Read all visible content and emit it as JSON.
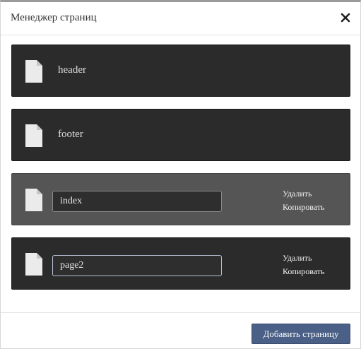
{
  "dialog": {
    "title": "Менеджер страниц",
    "close_icon": "close-icon"
  },
  "pages": [
    {
      "name": "header",
      "state": "static",
      "icon": "file-icon"
    },
    {
      "name": "footer",
      "state": "static",
      "icon": "file-icon"
    },
    {
      "name": "index",
      "state": "selected",
      "icon": "file-icon",
      "delete_label": "Удалить",
      "copy_label": "Копировать"
    },
    {
      "name": "page2",
      "state": "editing",
      "icon": "file-icon",
      "delete_label": "Удалить",
      "copy_label": "Копировать"
    }
  ],
  "footer": {
    "add_page_label": "Добавить страницу"
  },
  "colors": {
    "row_background": "#2b2b2b",
    "row_selected_background": "#555555",
    "accent_button": "#4b6086"
  }
}
